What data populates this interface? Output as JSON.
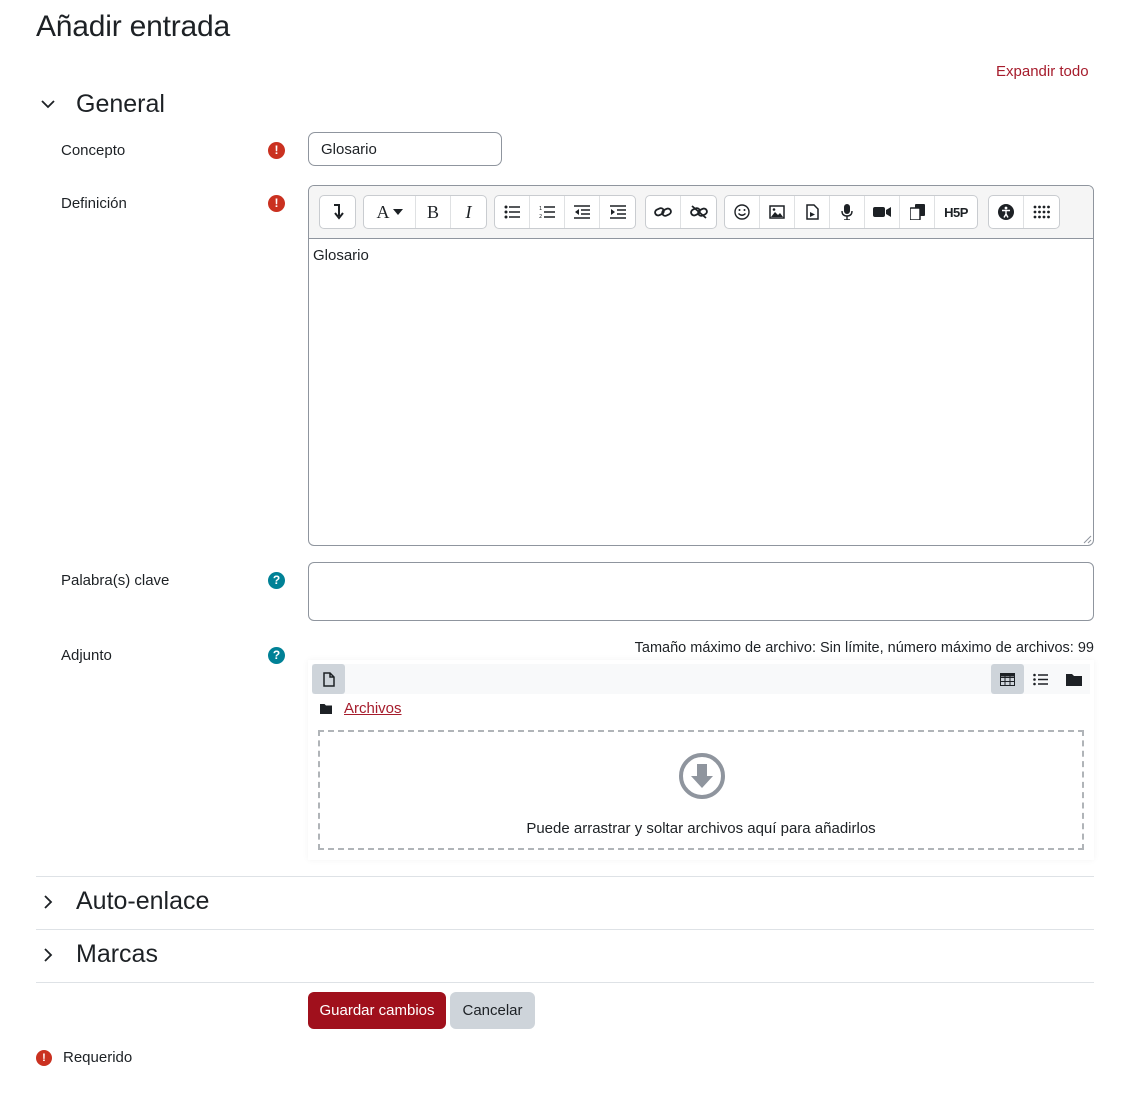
{
  "page": {
    "title": "Añadir entrada",
    "expand_all": "Expandir todo"
  },
  "sections": {
    "general": "General",
    "autolink": "Auto-enlace",
    "tags": "Marcas"
  },
  "fields": {
    "concept": {
      "label": "Concepto",
      "value": "Glosario"
    },
    "definition": {
      "label": "Definición",
      "content": "Glosario"
    },
    "keywords": {
      "label": "Palabra(s) clave",
      "value": ""
    },
    "attachment": {
      "label": "Adjunto"
    }
  },
  "editor": {
    "toolbar_icons": [
      "collapse-icon",
      "font-style-icon",
      "bold-icon",
      "italic-icon",
      "unordered-list-icon",
      "ordered-list-icon",
      "outdent-icon",
      "indent-icon",
      "link-icon",
      "unlink-icon",
      "emoji-icon",
      "image-icon",
      "media-icon",
      "record-audio-icon",
      "record-video-icon",
      "manage-files-icon",
      "h5p-icon",
      "accessibility-checker-icon",
      "special-characters-icon"
    ],
    "font_label": "A",
    "bold_label": "B",
    "italic_label": "I",
    "h5p_label": "H5P"
  },
  "filemanager": {
    "limits": "Tamaño máximo de archivo: Sin límite, número máximo de archivos: 99",
    "path_label": "Archivos",
    "drop_text": "Puede arrastrar y soltar archivos aquí para añadirlos"
  },
  "buttons": {
    "save": "Guardar cambios",
    "cancel": "Cancelar"
  },
  "footer": {
    "required": "Requerido"
  },
  "colors": {
    "accent": "#a61c2c",
    "primary_button": "#a0101c",
    "required": "#ca3120",
    "help": "#008196"
  }
}
